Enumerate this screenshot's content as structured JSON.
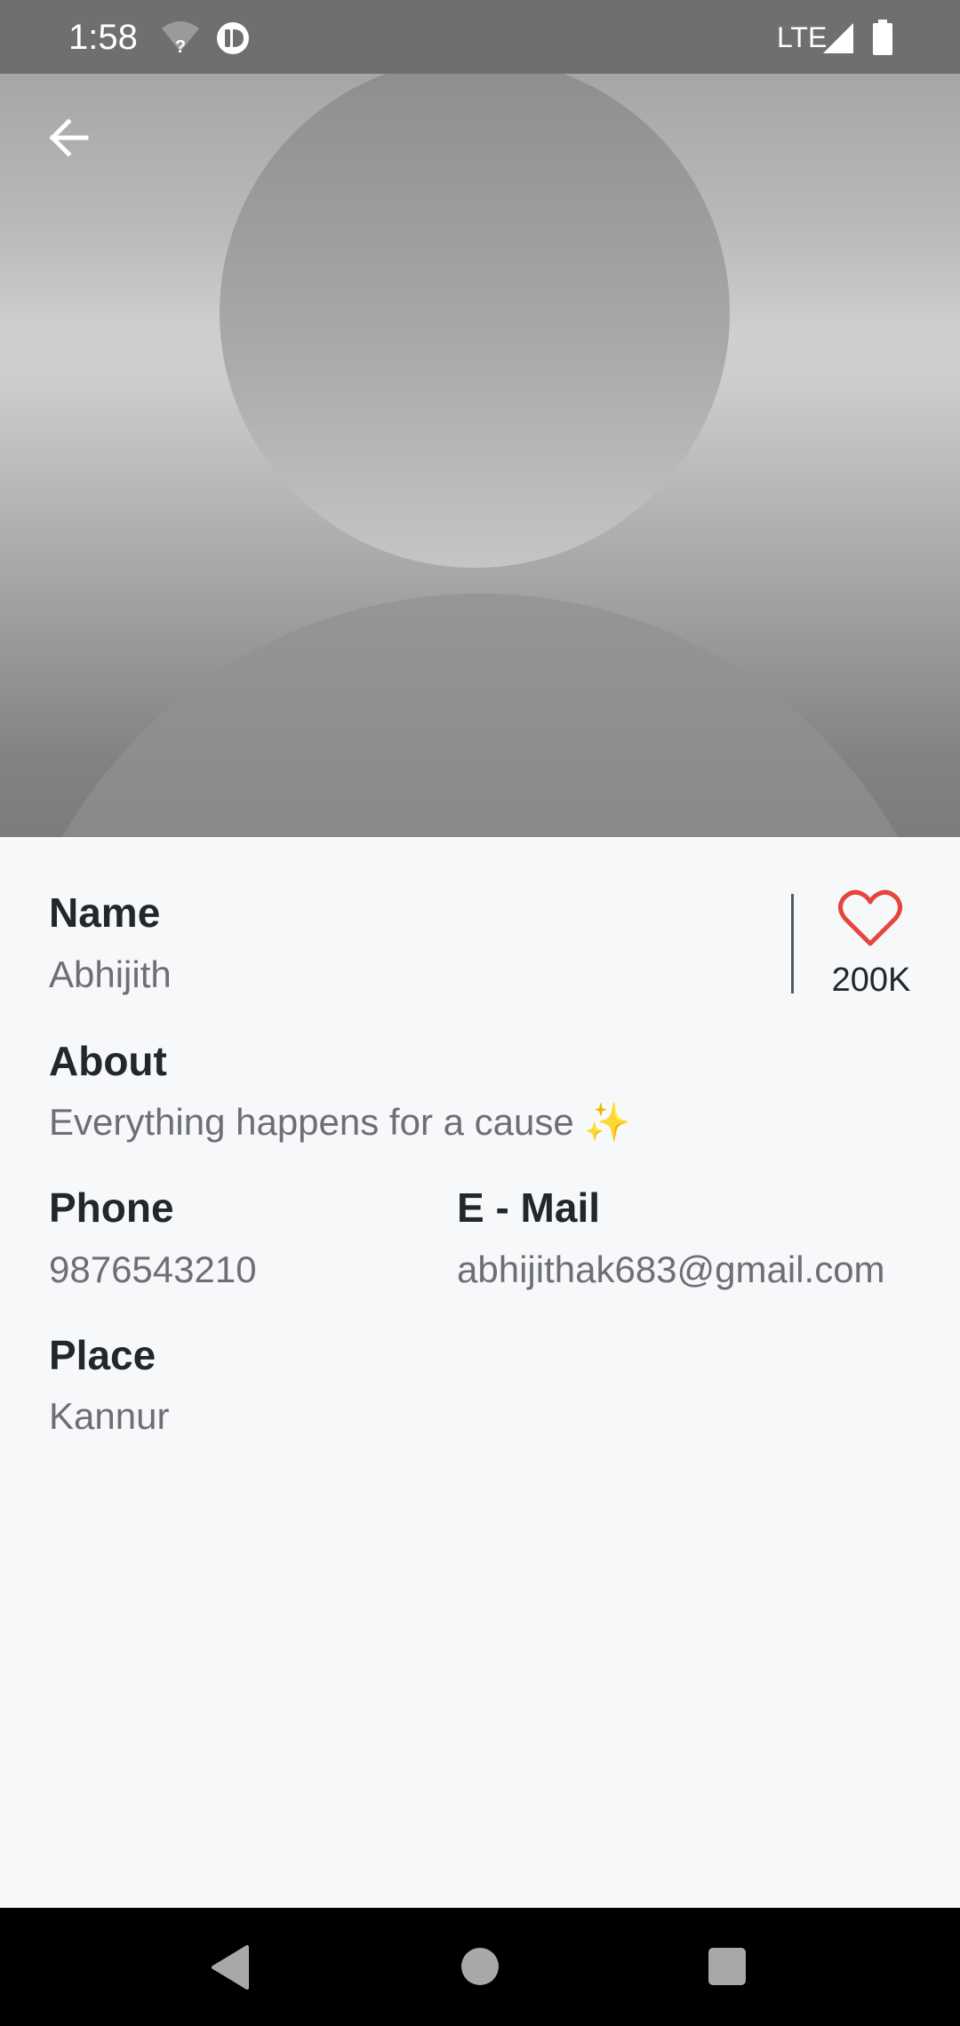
{
  "status_bar": {
    "time": "1:58",
    "network": "LTE",
    "icons": [
      "wifi-unknown-icon",
      "app-notification-icon",
      "signal-icon",
      "battery-icon"
    ]
  },
  "header": {
    "back_icon": "arrow-back-icon",
    "image": "default-avatar-placeholder"
  },
  "profile": {
    "name_label": "Name",
    "name": "Abhijith",
    "about_label": "About",
    "about": "Everything happens for a cause ✨",
    "phone_label": "Phone",
    "phone": "9876543210",
    "email_label": "E - Mail",
    "email": "abhijithak683@gmail.com",
    "place_label": "Place",
    "place": "Kannur"
  },
  "likes": {
    "icon": "heart-outline-icon",
    "count": "200K",
    "color": "#e5453c"
  },
  "nav_bar": {
    "items": [
      "nav-back-icon",
      "nav-home-icon",
      "nav-recents-icon"
    ]
  }
}
